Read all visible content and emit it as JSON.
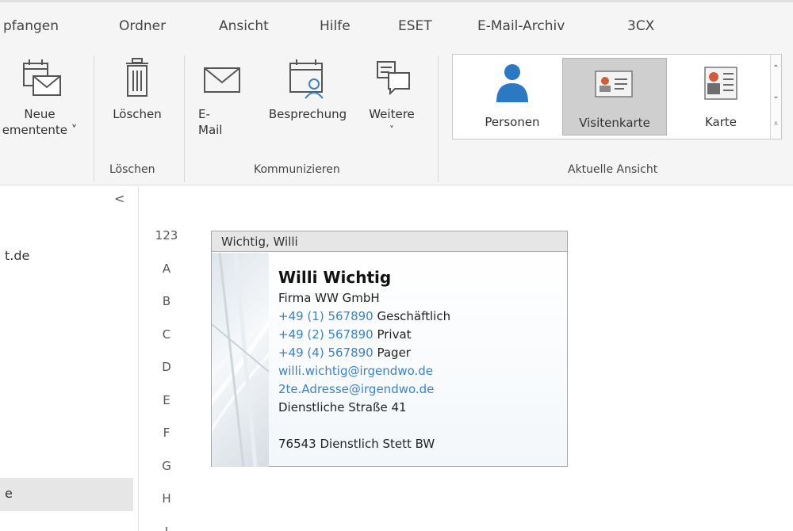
{
  "menu": [
    "pfangen",
    "Ordner",
    "Ansicht",
    "Hilfe",
    "ESET",
    "E-Mail-Archiv",
    "3CX"
  ],
  "ribbon": {
    "new_items": {
      "line1": "Neue",
      "line2": "ementente ˅"
    },
    "delete": {
      "label": "Löschen"
    },
    "email": {
      "line1": "E-",
      "line2": "Mail"
    },
    "meeting": {
      "label": "Besprechung"
    },
    "more": {
      "label": "Weitere",
      "chevron": "˅"
    },
    "groups": {
      "delete": "Löschen",
      "communicate": "Kommunizieren",
      "current_view": "Aktuelle Ansicht"
    },
    "views": [
      {
        "label": "Personen",
        "icon": "person-icon"
      },
      {
        "label": "Visitenkarte",
        "icon": "business-card-icon",
        "selected": true
      },
      {
        "label": "Karte",
        "icon": "card-icon"
      }
    ]
  },
  "leftpane": {
    "collapse": "<",
    "item1": "t.de",
    "item2": "e"
  },
  "alphabet": [
    "123",
    "A",
    "B",
    "C",
    "D",
    "E",
    "F",
    "G",
    "H",
    "I"
  ],
  "card": {
    "header": "Wichtig, Willi",
    "name": "Willi Wichtig",
    "company": "Firma WW GmbH",
    "phones": [
      {
        "number": "+49 (1) 567890",
        "type": "Geschäftlich"
      },
      {
        "number": "+49 (2) 567890",
        "type": "Privat"
      },
      {
        "number": "+49 (4) 567890",
        "type": "Pager"
      }
    ],
    "emails": [
      "willi.wichtig@irgendwo.de",
      "2te.Adresse@irgendwo.de"
    ],
    "street": "Dienstliche Straße 41",
    "city_line": "76543  Dienstlich Stett  BW"
  }
}
